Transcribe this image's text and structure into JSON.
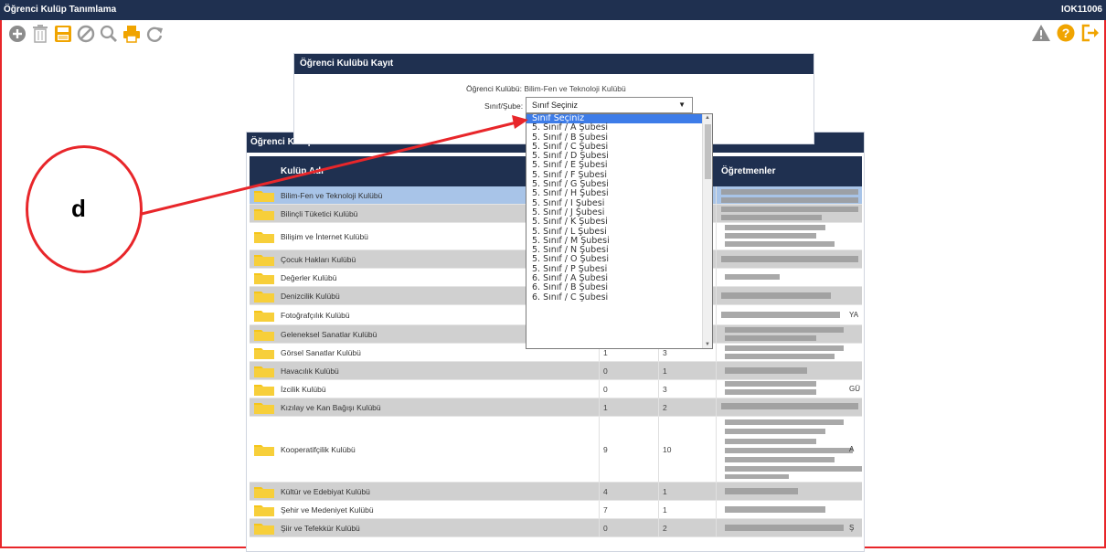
{
  "window": {
    "title": "Öğrenci Kulüp Tanımlama",
    "code": "IOK11006"
  },
  "toolbar": {
    "icons": [
      "add-icon",
      "delete-icon",
      "save-icon",
      "cancel-icon",
      "search-icon",
      "print-icon",
      "refresh-icon"
    ],
    "right_icons": [
      "warning-icon",
      "help-icon",
      "exit-icon"
    ]
  },
  "kayit": {
    "header": "Öğrenci Kulübü Kayıt",
    "kulup_label": "Öğrenci Kulübü:",
    "kulup_value": "Bilim-Fen ve Teknoloji Kulübü",
    "sube_label": "Sınıf/Şube:",
    "sube_selected": "Sınıf Seçiniz"
  },
  "dropdown": {
    "options": [
      "Sınıf Seçiniz",
      "5. Sınıf / A Şubesi",
      "5. Sınıf / B Şubesi",
      "5. Sınıf / C Şubesi",
      "5. Sınıf / D Şubesi",
      "5. Sınıf / E Şubesi",
      "5. Sınıf / F Şubesi",
      "5. Sınıf / G Şubesi",
      "5. Sınıf / H Şubesi",
      "5. Sınıf / I Şubesi",
      "5. Sınıf / J Şubesi",
      "5. Sınıf / K Şubesi",
      "5. Sınıf / L Şubesi",
      "5. Sınıf / M Şubesi",
      "5. Sınıf / N Şubesi",
      "5. Sınıf / O Şubesi",
      "5. Sınıf / P Şubesi",
      "6. Sınıf / A Şubesi",
      "6. Sınıf / B Şubesi",
      "6. Sınıf / C Şubesi"
    ]
  },
  "kulupler": {
    "header": "Öğrenci Kulüpleri",
    "columns": {
      "name": "Kulüp Adı",
      "teachers": "Öğretmenler"
    },
    "rows": [
      {
        "name": "Bilim-Fen ve Teknoloji Kulübü",
        "c2": "",
        "c3": "",
        "teacher_tail": ""
      },
      {
        "name": "Bilinçli Tüketici Kulübü",
        "c2": "",
        "c3": "",
        "teacher_tail": ""
      },
      {
        "name": "Bilişim ve İnternet Kulübü",
        "c2": "",
        "c3": "",
        "teacher_tail": ""
      },
      {
        "name": "Çocuk Hakları Kulübü",
        "c2": "",
        "c3": "",
        "teacher_tail": ""
      },
      {
        "name": "Değerler Kulübü",
        "c2": "",
        "c3": "",
        "teacher_tail": ""
      },
      {
        "name": "Denizcilik Kulübü",
        "c2": "",
        "c3": "",
        "teacher_tail": ""
      },
      {
        "name": "Fotoğrafçılık Kulübü",
        "c2": "",
        "c3": "",
        "teacher_tail": "YA"
      },
      {
        "name": "Geleneksel Sanatlar Kulübü",
        "c2": "",
        "c3": "",
        "teacher_tail": ""
      },
      {
        "name": "Görsel Sanatlar Kulübü",
        "c2": "1",
        "c3": "3",
        "teacher_tail": ""
      },
      {
        "name": "Havacılık Kulübü",
        "c2": "0",
        "c3": "1",
        "teacher_tail": ""
      },
      {
        "name": "İzcilik Kulübü",
        "c2": "0",
        "c3": "3",
        "teacher_tail": "GÜ"
      },
      {
        "name": "Kızılay ve Kan Bağışı Kulübü",
        "c2": "1",
        "c3": "2",
        "teacher_tail": ""
      },
      {
        "name": "Kooperatifçilik Kulübü",
        "c2": "9",
        "c3": "10",
        "teacher_tail": "A"
      },
      {
        "name": "Kültür ve Edebiyat Kulübü",
        "c2": "4",
        "c3": "1",
        "teacher_tail": ""
      },
      {
        "name": "Şehir ve Medeniyet Kulübü",
        "c2": "7",
        "c3": "1",
        "teacher_tail": ""
      },
      {
        "name": "Şiir ve Tefekkür Kulübü",
        "c2": "0",
        "c3": "2",
        "teacher_tail": "Ş"
      }
    ]
  },
  "annotation": {
    "letter": "d"
  },
  "colors": {
    "header": "#1f3050",
    "accent_red": "#e8262a",
    "folder": "#f5c518",
    "selected_row": "#a8c4e8",
    "alt_row": "#d0d0d0",
    "option_highlight": "#3d7ce8"
  }
}
